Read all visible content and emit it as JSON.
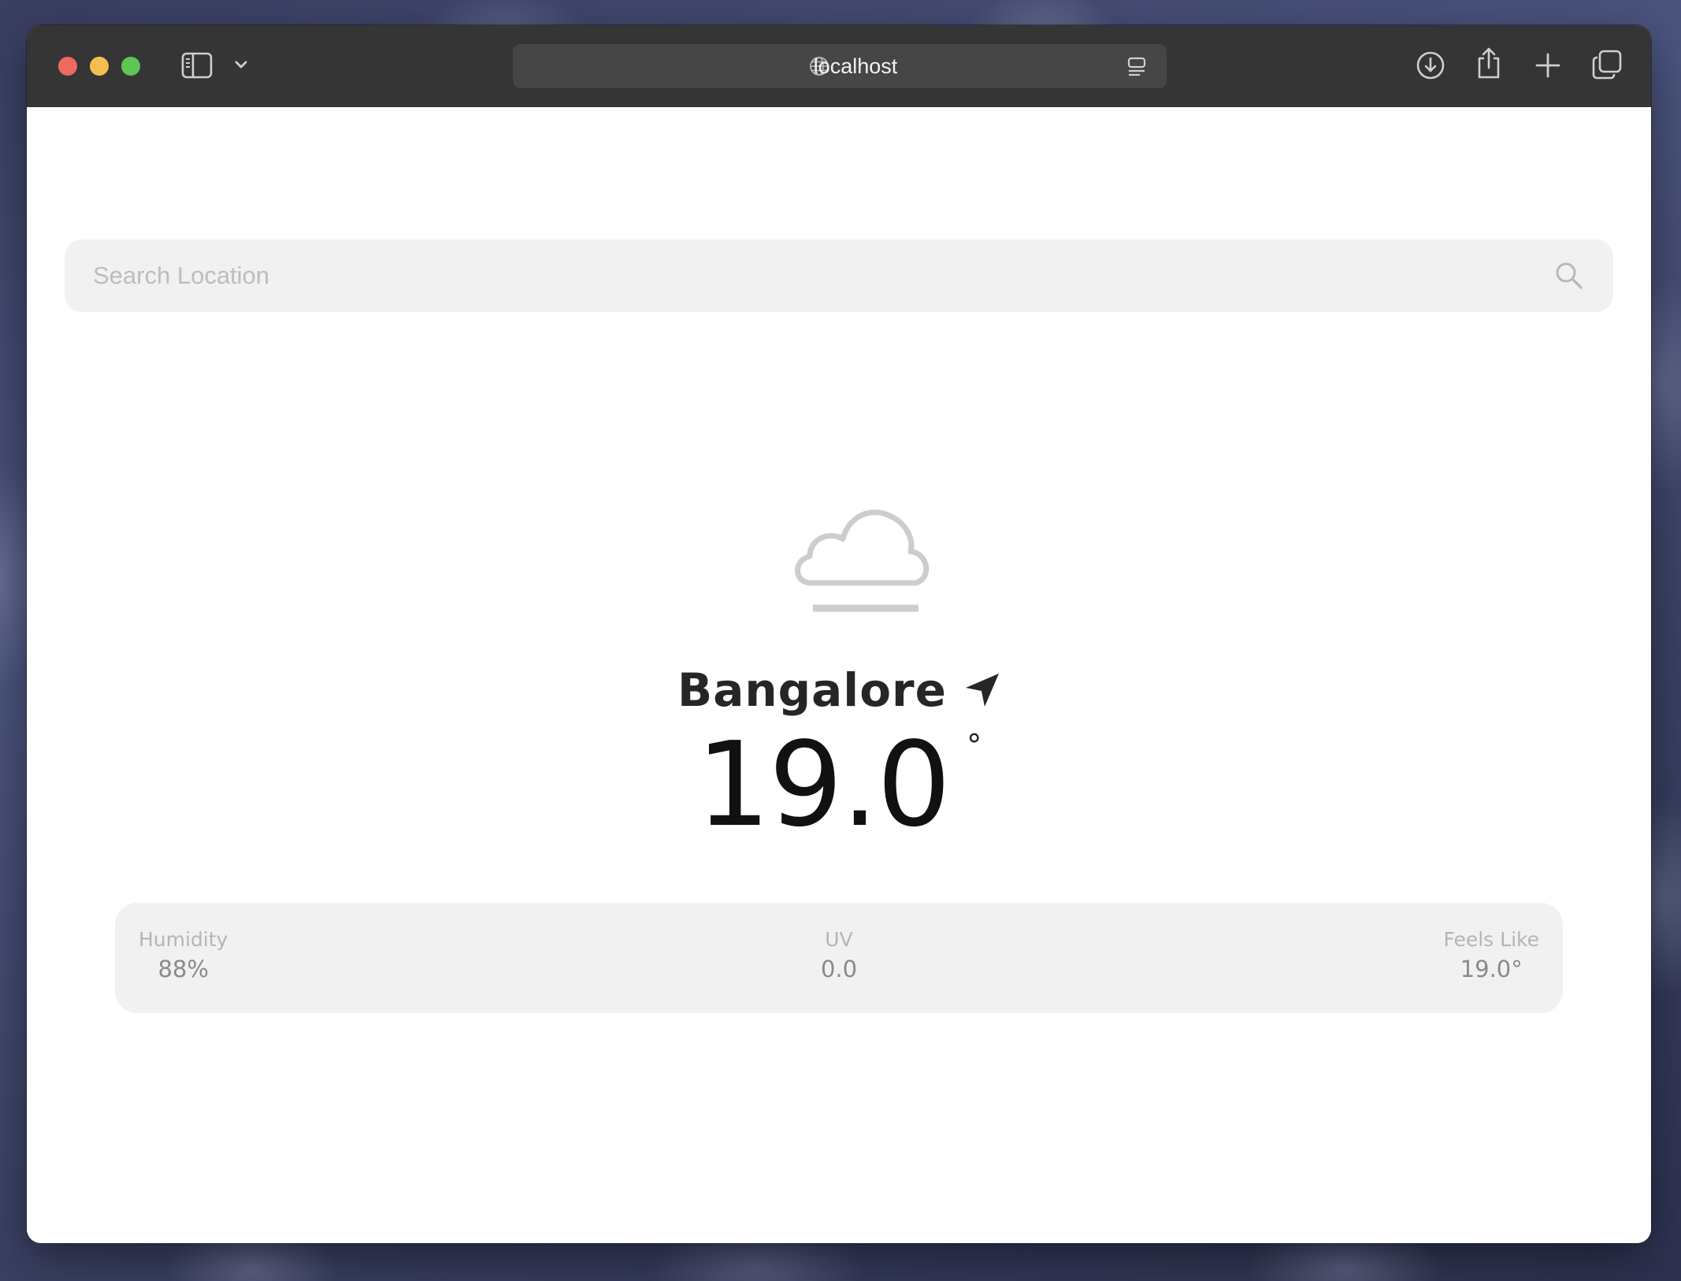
{
  "browser": {
    "address": "localhost",
    "icons": {
      "sidebar": "sidebar-icon",
      "chevron": "chevron-down-icon",
      "globe": "globe-icon",
      "reader": "reader-icon",
      "download": "download-icon",
      "share": "share-icon",
      "new_tab": "plus-icon",
      "tabs": "tab-overview-icon"
    }
  },
  "search": {
    "placeholder": "Search Location",
    "value": "",
    "icon": "search-icon"
  },
  "weather": {
    "condition_icon": "cloud-fog-icon",
    "city": "Bangalore",
    "location_icon": "location-arrow-icon",
    "temperature": "19.0",
    "degree_symbol": "°"
  },
  "stats": {
    "humidity": {
      "label": "Humidity",
      "value": "88%"
    },
    "uv": {
      "label": "UV",
      "value": "0.0"
    },
    "feels_like": {
      "label": "Feels Like",
      "value": "19.0°"
    }
  },
  "colors": {
    "toolbar": "#353536",
    "address_bar": "#464647",
    "card_background": "#f1f1f1",
    "traffic_red": "#ed6a5e",
    "traffic_yellow": "#f4bf4f",
    "traffic_green": "#61c554"
  }
}
